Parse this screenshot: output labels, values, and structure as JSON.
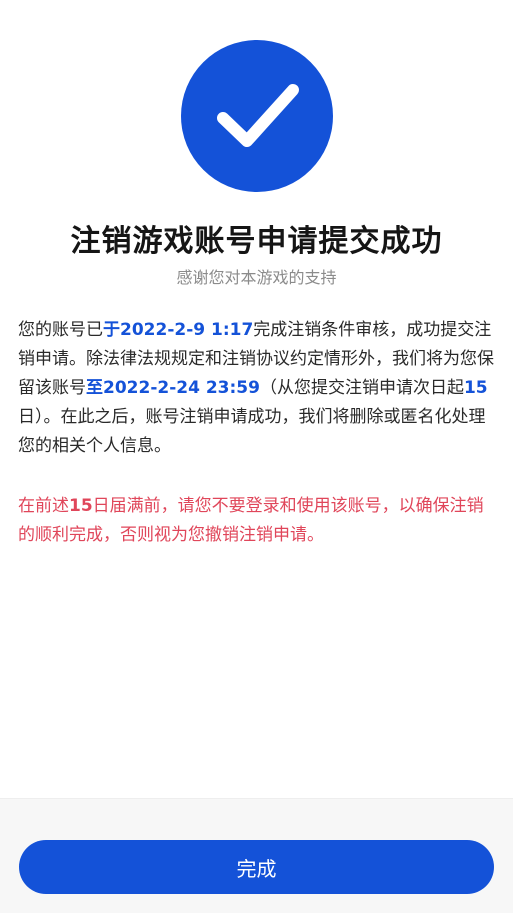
{
  "colors": {
    "accent": "#1452d8",
    "warning": "#e0465a",
    "subtitle": "#8b8b8b",
    "body": "#2a2a2a"
  },
  "icon": "checkmark-circle-icon",
  "title": "注销游戏账号申请提交成功",
  "subtitle": "感谢您对本游戏的支持",
  "body": {
    "part1": "您的账号已",
    "hl1": "于2022-2-9 1:17",
    "part2": "完成注销条件审核，成功提交注销申请。除法律法规规定和注销协议约定情形外，我们将为您保留该账号",
    "hl2": "至2022-2-24 23:59",
    "part3": "（从您提交注销申请次日起",
    "hl3": "15",
    "part4": "日）。在此之后，账号注销申请成功，我们将删除或匿名化处理您的相关个人信息。"
  },
  "warning": {
    "part1": "在前述",
    "bold": "15",
    "part2": "日届满前，请您不要登录和使用该账号，以确保注销的顺利完成，否则视为您撤销注销申请。"
  },
  "footer": {
    "done_label": "完成"
  }
}
